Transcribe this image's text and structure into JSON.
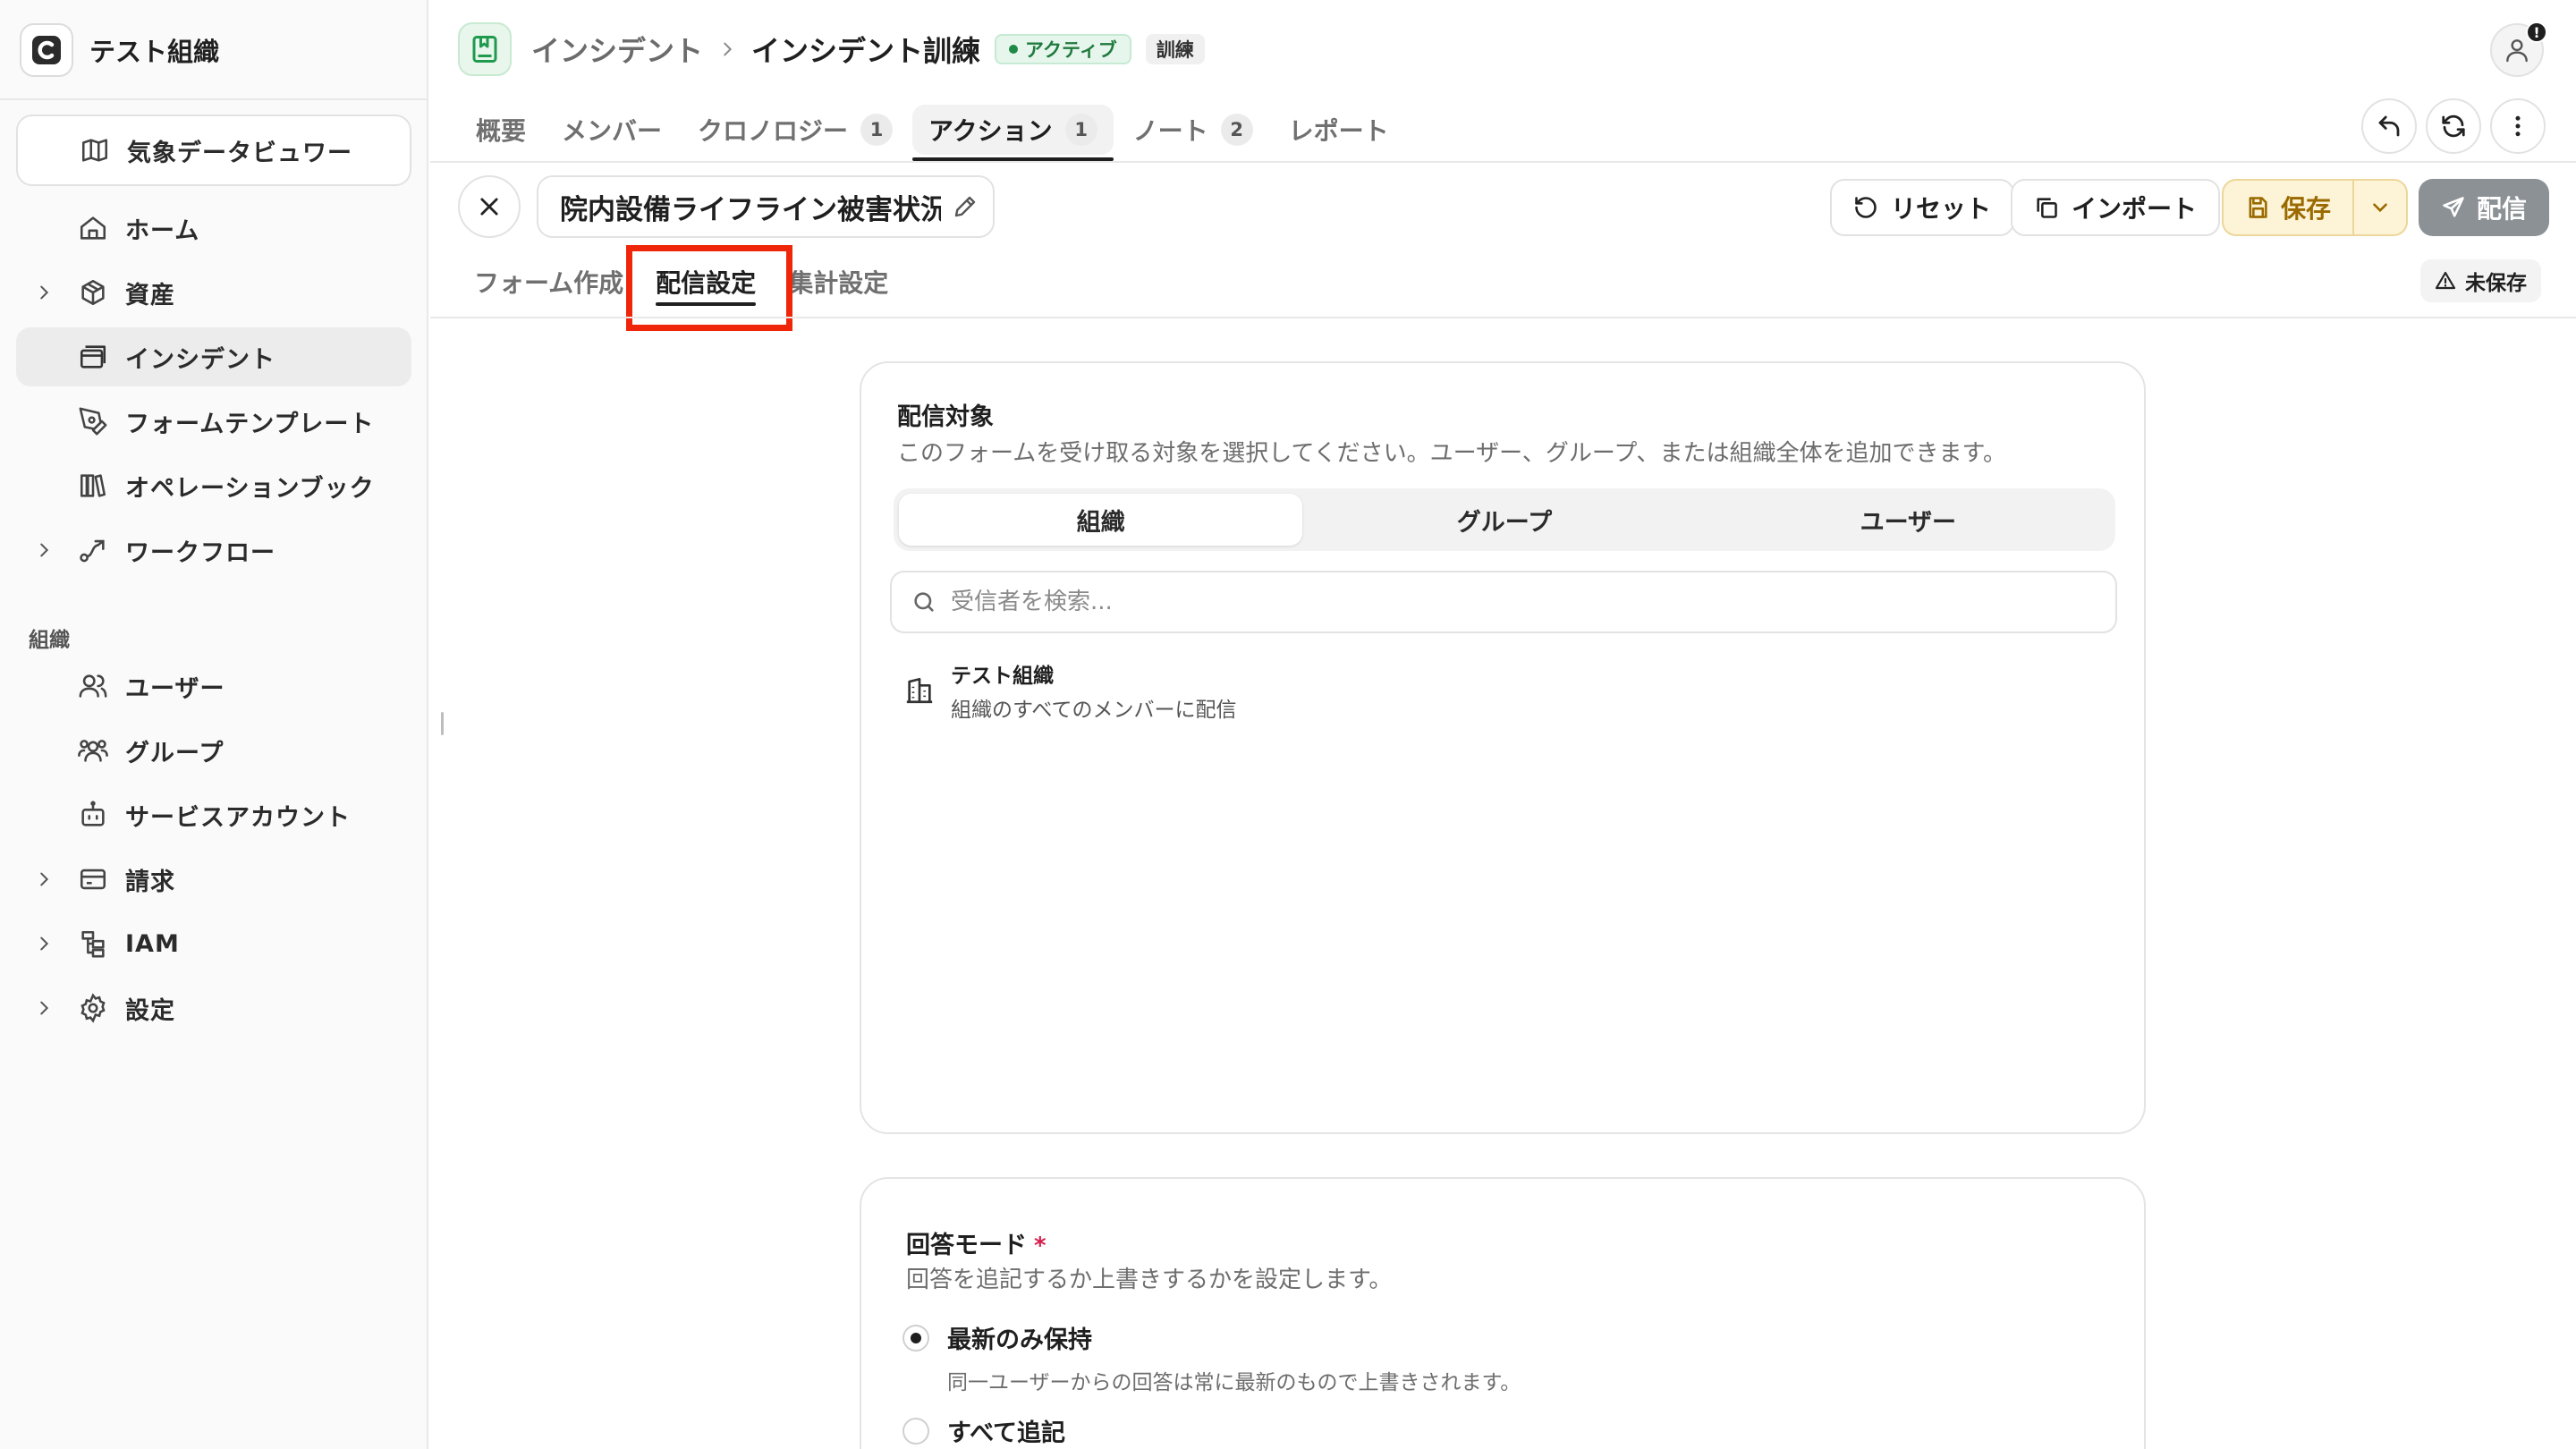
{
  "sidebar": {
    "org_name": "テスト組織",
    "viewer_label": "気象データビュワー",
    "items": [
      {
        "label": "ホーム"
      },
      {
        "label": "資産"
      },
      {
        "label": "インシデント"
      },
      {
        "label": "フォームテンプレート"
      },
      {
        "label": "オペレーションブック"
      },
      {
        "label": "ワークフロー"
      }
    ],
    "section_label": "組織",
    "org_items": [
      {
        "label": "ユーザー"
      },
      {
        "label": "グループ"
      },
      {
        "label": "サービスアカウント"
      },
      {
        "label": "請求"
      },
      {
        "label": "IAM"
      },
      {
        "label": "設定"
      }
    ]
  },
  "header": {
    "breadcrumb_parent": "インシデント",
    "breadcrumb_current": "インシデント訓練",
    "status_badge": "アクティブ",
    "type_badge": "訓練",
    "avatar_alert": "!"
  },
  "tabs": [
    {
      "label": "概要"
    },
    {
      "label": "メンバー"
    },
    {
      "label": "クロノロジー",
      "count": "1"
    },
    {
      "label": "アクション",
      "count": "1"
    },
    {
      "label": "ノート",
      "count": "2"
    },
    {
      "label": "レポート"
    }
  ],
  "editor": {
    "title": "院内設備ライフライン被害状況",
    "reset_label": "リセット",
    "import_label": "インポート",
    "save_label": "保存",
    "send_label": "配信",
    "unsaved_label": "未保存",
    "subtabs": [
      {
        "label": "フォーム作成"
      },
      {
        "label": "配信設定"
      },
      {
        "label": "集計設定"
      }
    ]
  },
  "distribution": {
    "title": "配信対象",
    "description": "このフォームを受け取る対象を選択してください。ユーザー、グループ、または組織全体を追加できます。",
    "segments": [
      {
        "label": "組織"
      },
      {
        "label": "グループ"
      },
      {
        "label": "ユーザー"
      }
    ],
    "search_placeholder": "受信者を検索...",
    "recipient_name": "テスト組織",
    "recipient_desc": "組織のすべてのメンバーに配信"
  },
  "answer_mode": {
    "title": "回答モード",
    "required_mark": "*",
    "description": "回答を追記するか上書きするかを設定します。",
    "options": [
      {
        "label": "最新のみ保持",
        "desc": "同一ユーザーからの回答は常に最新のもので上書きされます。",
        "selected": true
      },
      {
        "label": "すべて追記",
        "selected": false
      }
    ]
  }
}
